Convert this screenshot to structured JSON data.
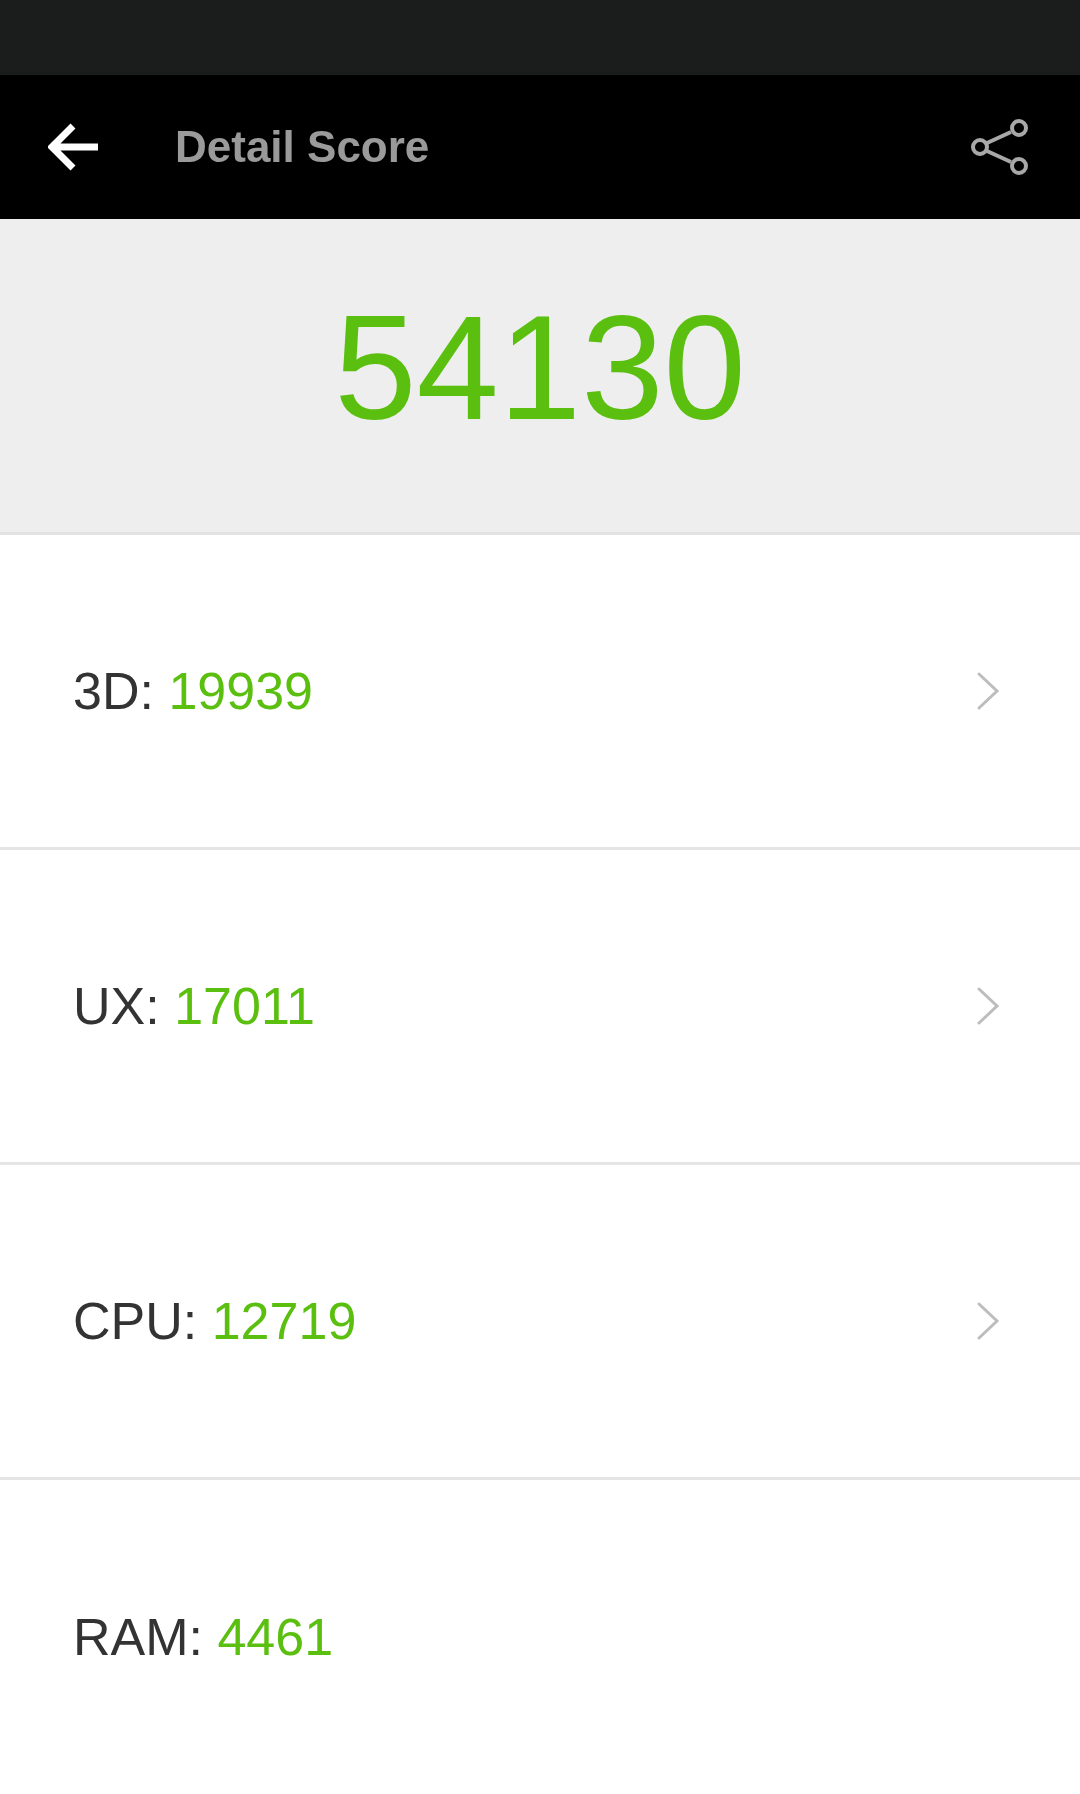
{
  "toolbar": {
    "title": "Detail Score"
  },
  "total_score": "54130",
  "categories": [
    {
      "label": "3D:",
      "score": "19939",
      "chevron": true
    },
    {
      "label": "UX:",
      "score": "17011",
      "chevron": true
    },
    {
      "label": "CPU:",
      "score": "12719",
      "chevron": true
    },
    {
      "label": "RAM:",
      "score": "4461",
      "chevron": false
    }
  ]
}
